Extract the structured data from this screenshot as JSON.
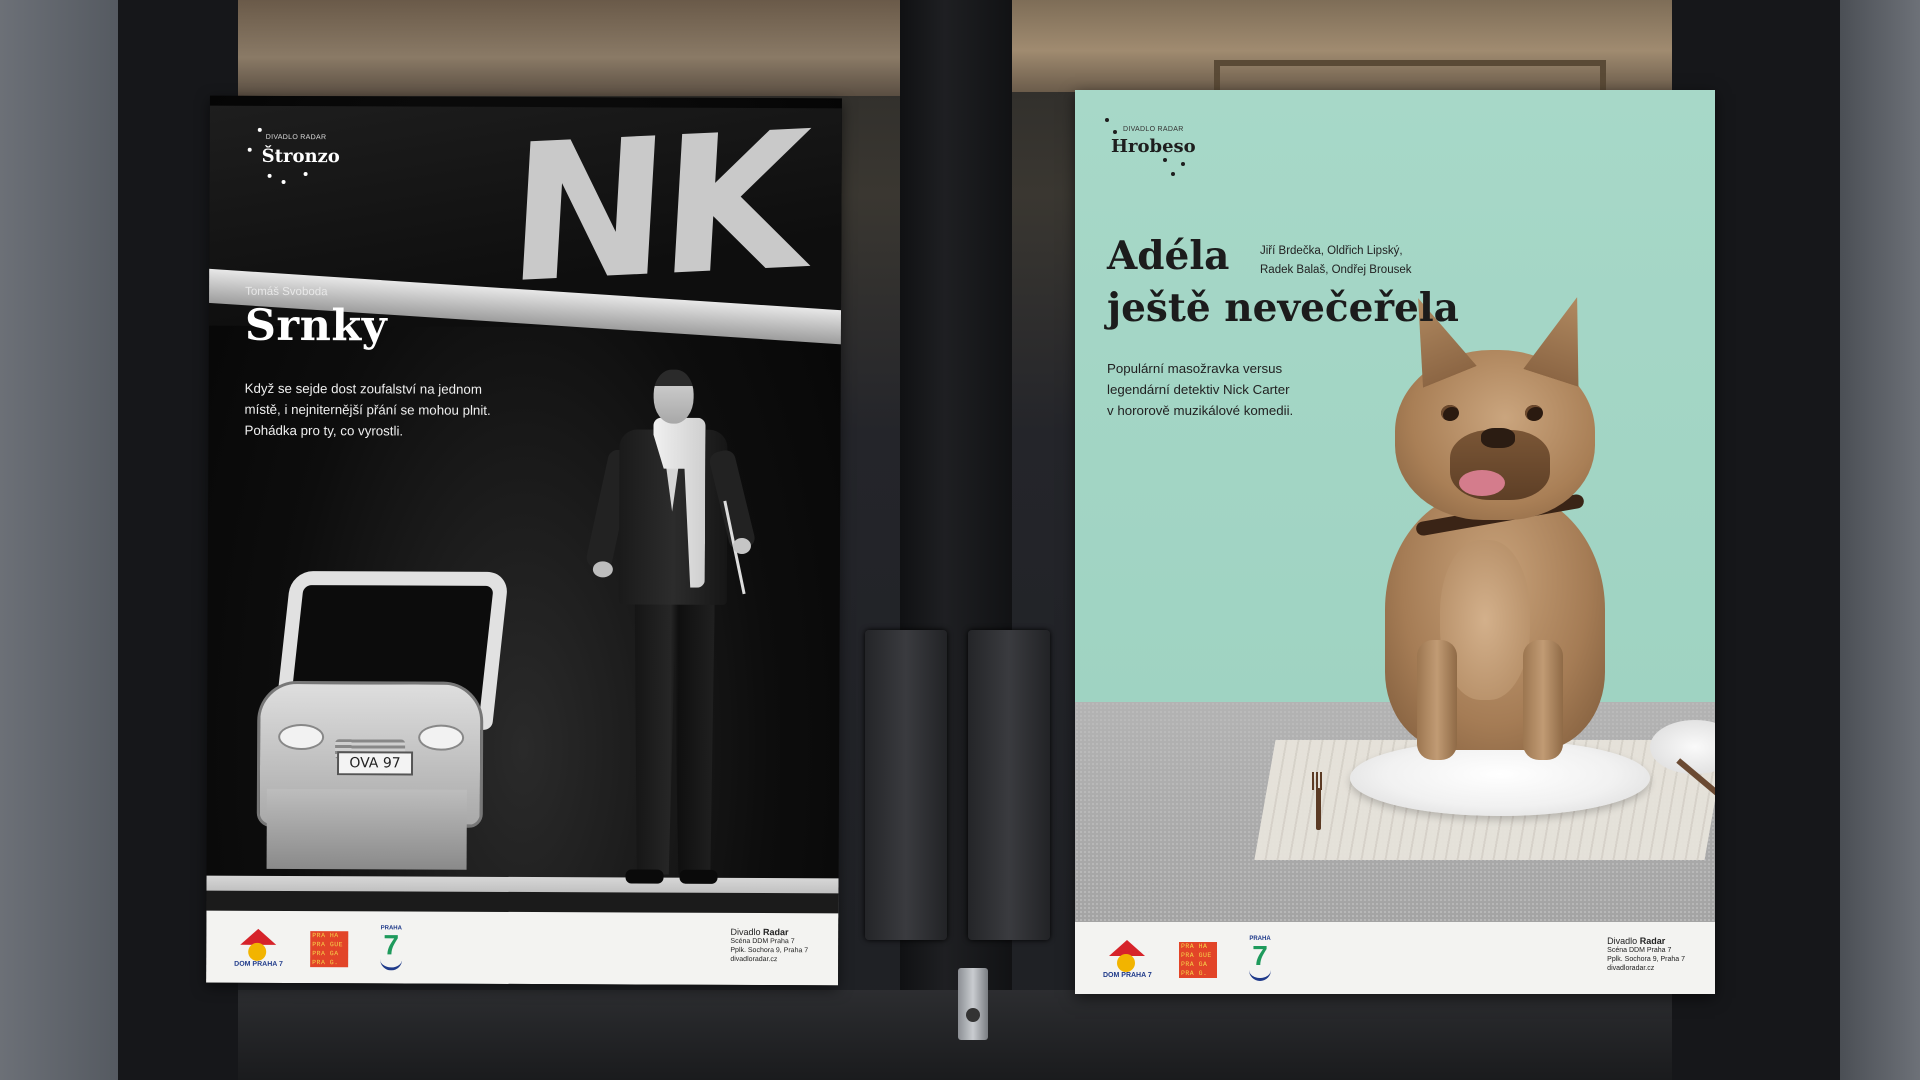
{
  "poster_left": {
    "brand_small": "DIVADLO RADAR",
    "brand_name": "Štronzo",
    "author": "Tomáš Svoboda",
    "title": "Srnky",
    "description_lines": [
      "Když se sejde dost zoufalství na jednom",
      "místě, i nejniternější přání se mohou plnit.",
      "Pohádka pro ty, co vyrostli."
    ],
    "plate_text": "OVA 97",
    "footer": {
      "logo_dom": "DOM PRAHA 7",
      "logo_prague": [
        "PRA HA",
        "PRA GUE",
        "PRA GA",
        "PRA G."
      ],
      "logo_p7_small": "PRAHA",
      "logo_p7_big": "7",
      "venue_prefix": "Divadlo",
      "venue_bold": "Radar",
      "venue_lines": [
        "Scéna DDM Praha 7",
        "Pplk. Sochora 9, Praha 7",
        "divadloradar.cz"
      ]
    }
  },
  "poster_right": {
    "brand_small": "DIVADLO RADAR",
    "brand_name": "Hrobeso",
    "title_lines": [
      "Adéla",
      "ještě nevečeřela"
    ],
    "authors_lines": [
      "Jiří Brdečka, Oldřich Lipský,",
      "Radek Balaš, Ondřej Brousek"
    ],
    "description_lines": [
      "Populární masožravka versus",
      "legendární detektiv Nick Carter",
      "v hororově muzikálové komedii."
    ],
    "footer": {
      "logo_dom": "DOM PRAHA 7",
      "logo_prague": [
        "PRA HA",
        "PRA GUE",
        "PRA GA",
        "PRA G."
      ],
      "logo_p7_small": "PRAHA",
      "logo_p7_big": "7",
      "venue_prefix": "Divadlo",
      "venue_bold": "Radar",
      "venue_lines": [
        "Scéna DDM Praha 7",
        "Pplk. Sochora 9, Praha 7",
        "divadloradar.cz"
      ]
    }
  },
  "colors": {
    "mint": "#a2d6c6",
    "poster_dark": "#0b0b0b",
    "footer": "#f3f3f1",
    "dom_red": "#d6232a",
    "prague_red": "#e24428",
    "p7_green": "#1e9a5c"
  }
}
